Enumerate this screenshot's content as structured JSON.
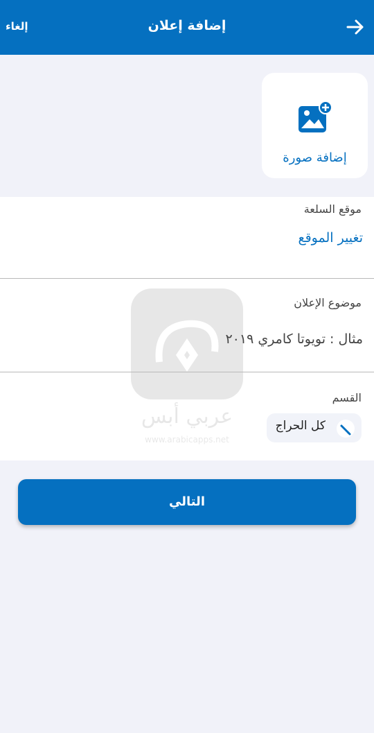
{
  "header": {
    "title": "إضافة إعلان",
    "cancel_label": "إلغاء",
    "back_icon": "arrow-right-icon",
    "background": "#0570c0"
  },
  "photo": {
    "label": "إضافة صورة",
    "icon": "add-photo-icon"
  },
  "location": {
    "label": "موقع السلعة",
    "link": "تغيير الموقع"
  },
  "ad_title": {
    "label": "موضوع الإعلان",
    "placeholder": "مثال : تويوتا كامري ٢٠١٩"
  },
  "category": {
    "label": "القسم",
    "value": "كل الحراج",
    "edit_icon": "pencil-icon"
  },
  "next_button": {
    "label": "التالي"
  },
  "watermark": {
    "text": "عربي أبس",
    "subtext": "www.arabicapps.net"
  },
  "colors": {
    "accent": "#0570c0",
    "background": "#f1f2f9"
  }
}
